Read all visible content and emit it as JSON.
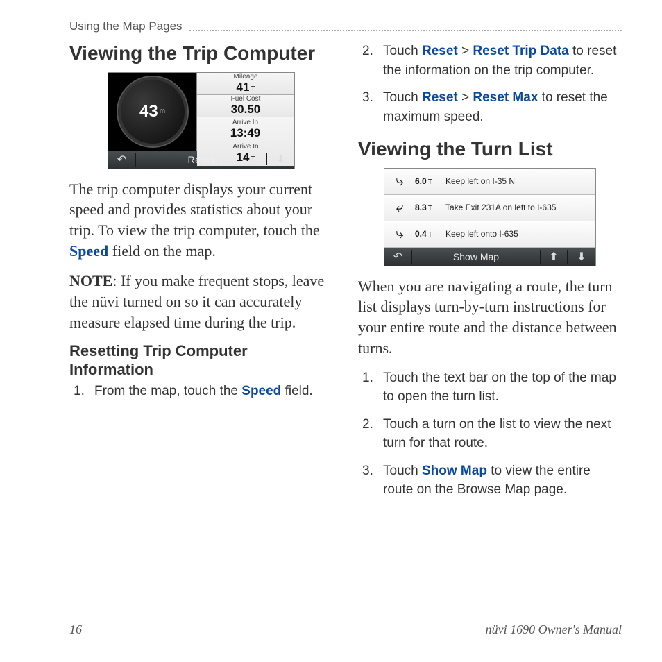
{
  "header": {
    "breadcrumb": "Using the Map Pages"
  },
  "left": {
    "h1": "Viewing the Trip Computer",
    "trip": {
      "speed": "43",
      "speed_unit": "m",
      "mileage_lbl": "Mileage",
      "mileage_val": "41",
      "mileage_unit": "T",
      "fuel_lbl": "Fuel Cost",
      "fuel_val": "30.50",
      "arrive_in_lbl": "Arrive In",
      "arrive_in_val": "13:49",
      "arrive_in2_lbl": "Arrive In",
      "arrive_in2_val": "14",
      "arrive_in2_unit": "T",
      "reset_btn": "Reset"
    },
    "p1_a": "The trip computer displays your current speed and provides statistics about your trip. To view the trip computer, touch the ",
    "p1_ui": "Speed",
    "p1_b": " field on the map.",
    "note_lbl": "NOTE",
    "note_txt": ": If you make frequent stops, leave the nüvi turned on so it can accurately measure elapsed time during the trip.",
    "h2": "Resetting Trip Computer Information",
    "step1_a": "From the map, touch the ",
    "step1_ui": "Speed",
    "step1_b": " field."
  },
  "right": {
    "step2_a": "Touch ",
    "step2_ui1": "Reset",
    "step2_sep": " > ",
    "step2_ui2": "Reset Trip Data",
    "step2_b": " to reset the information on the trip computer.",
    "step3_a": "Touch ",
    "step3_ui1": "Reset",
    "step3_sep": " > ",
    "step3_ui2": "Reset Max",
    "step3_b": " to reset the maximum speed.",
    "h1": "Viewing the Turn List",
    "turns": [
      {
        "dist": "6.0",
        "unit": "T",
        "txt": "Keep left on I-35 N"
      },
      {
        "dist": "8.3",
        "unit": "T",
        "txt": "Take Exit 231A on left to I-635"
      },
      {
        "dist": "0.4",
        "unit": "T",
        "txt": "Keep left onto I-635"
      }
    ],
    "show_map": "Show Map",
    "p1": "When you are navigating a route, the turn list displays turn-by-turn instructions for your entire route and the distance between turns.",
    "tstep1": "Touch the text bar on the top of the map to open the turn list.",
    "tstep2": "Touch a turn on the list to view the next turn for that route.",
    "tstep3_a": "Touch ",
    "tstep3_ui": "Show Map",
    "tstep3_b": " to view the entire route on the Browse Map page."
  },
  "footer": {
    "page": "16",
    "manual": "nüvi 1690 Owner's Manual"
  }
}
